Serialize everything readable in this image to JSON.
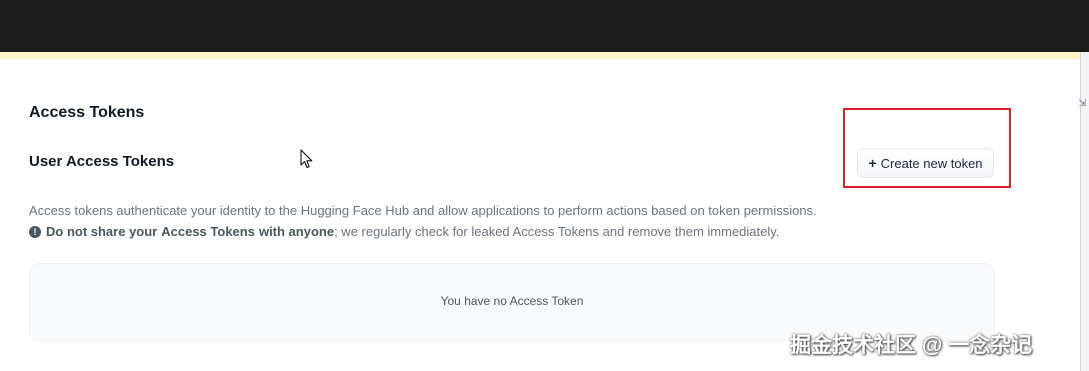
{
  "header": {
    "section_title": "Access Tokens",
    "sub_title": "User Access Tokens"
  },
  "actions": {
    "create_label": "Create new token",
    "create_icon": "+"
  },
  "description": "Access tokens authenticate your identity to the Hugging Face Hub and allow applications to perform actions based on token permissions.",
  "warning": {
    "icon": "!",
    "part1": "Do not share your ",
    "part2": "Access Tokens",
    "part3": " with anyone",
    "rest": "; we regularly check for leaked Access Tokens and remove them immediately."
  },
  "empty_state": "You have no Access Token",
  "watermark": "掘金技术社区 @ 一念杂记",
  "colors": {
    "topbar": "#1c1c1c",
    "accent_strip": "#fdf3c7",
    "highlight": "#e11d2a"
  }
}
